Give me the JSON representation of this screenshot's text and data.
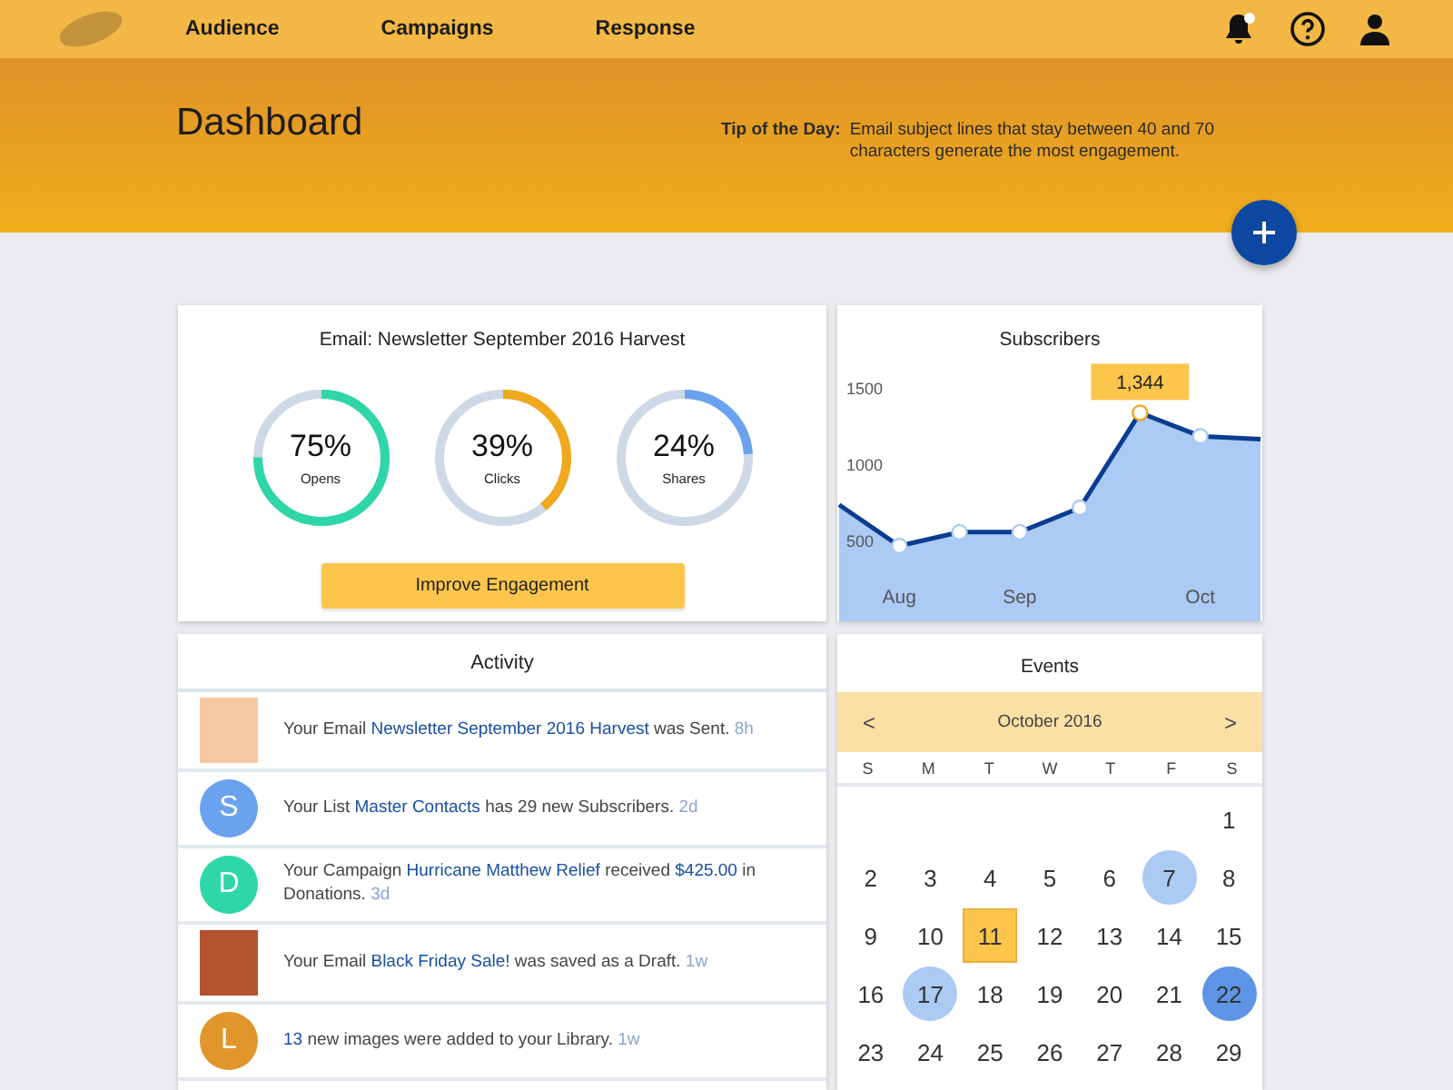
{
  "nav": {
    "items": [
      {
        "label": "Audience"
      },
      {
        "label": "Campaigns"
      },
      {
        "label": "Response"
      }
    ],
    "notifications_unread": true
  },
  "banner": {
    "title": "Dashboard",
    "tip_label": "Tip of the Day:",
    "tip_text": "Email subject lines that stay between 40 and 70 characters generate the most engagement."
  },
  "email_card": {
    "title": "Email: Newsletter September 2016 Harvest",
    "gauges": [
      {
        "value": "75%",
        "label": "Opens",
        "level": 0.75,
        "color": "#2fd6a8"
      },
      {
        "value": "39%",
        "label": "Clicks",
        "level": 0.39,
        "color": "#f0a81c"
      },
      {
        "value": "24%",
        "label": "Shares",
        "level": 0.24,
        "color": "#6aa2ee"
      }
    ],
    "button": "Improve Engagement"
  },
  "subscribers_card": {
    "title": "Subscribers",
    "chart_data": {
      "type": "area",
      "categories": [
        null,
        "Aug",
        null,
        "Sep",
        null,
        null,
        "Oct",
        null
      ],
      "series": [
        {
          "color": "#0a3d91",
          "values": [
            740,
            470,
            560,
            560,
            720,
            1344,
            1190,
            1170
          ]
        }
      ],
      "ylim": [
        -25,
        2050
      ],
      "yticks": [
        500,
        1000,
        1500
      ],
      "annotations": [
        {
          "y": 1344,
          "text": "1,344"
        }
      ]
    }
  },
  "activity": {
    "title": "Activity",
    "items": [
      {
        "kind": "image",
        "segments": [
          {
            "kind": "text",
            "text": "Your Email "
          },
          {
            "kind": "link",
            "text": "Newsletter September 2016 Harvest"
          },
          {
            "kind": "text",
            "text": " was Sent."
          }
        ],
        "time": "8h"
      },
      {
        "kind": "avatar",
        "letter": "S",
        "color": "#6aa2ee",
        "segments": [
          {
            "kind": "text",
            "text": "Your List "
          },
          {
            "kind": "link",
            "text": "Master Contacts"
          },
          {
            "kind": "text",
            "text": " has 29 new Subscribers."
          }
        ],
        "time": "2d"
      },
      {
        "kind": "avatar",
        "letter": "D",
        "color": "#2fd6a8",
        "segments": [
          {
            "kind": "text",
            "text": "Your Campaign "
          },
          {
            "kind": "link",
            "text": "Hurricane Matthew Relief"
          },
          {
            "kind": "text",
            "text": " received "
          },
          {
            "kind": "link",
            "text": "$425.00"
          },
          {
            "kind": "text",
            "text": " in Donations."
          }
        ],
        "time": "3d"
      },
      {
        "kind": "image",
        "segments": [
          {
            "kind": "text",
            "text": "Your Email "
          },
          {
            "kind": "link",
            "text": "Black Friday Sale!"
          },
          {
            "kind": "text",
            "text": " was saved as a Draft."
          }
        ],
        "time": "1w"
      },
      {
        "kind": "avatar",
        "letter": "L",
        "color": "#e0962a",
        "segments": [
          {
            "kind": "link",
            "text": "13"
          },
          {
            "kind": "text",
            "text": " new images were added to your Library."
          }
        ],
        "time": "1w"
      }
    ]
  },
  "events": {
    "title": "Events",
    "prev": "<",
    "month": "October 2016",
    "next": ">",
    "weekdays": [
      "S",
      "M",
      "T",
      "W",
      "T",
      "F",
      "S"
    ],
    "weeks": [
      {
        "days": [
          {
            "day": "1",
            "kind": "plain"
          }
        ]
      },
      {
        "days": [
          {
            "day": "2",
            "kind": "plain"
          },
          {
            "day": "3",
            "kind": "plain"
          },
          {
            "day": "4",
            "kind": "plain"
          },
          {
            "day": "5",
            "kind": "plain"
          },
          {
            "day": "6",
            "kind": "plain"
          },
          {
            "day": "7",
            "kind": "event"
          },
          {
            "day": "8",
            "kind": "plain"
          }
        ]
      },
      {
        "days": [
          {
            "day": "9",
            "kind": "plain"
          },
          {
            "day": "10",
            "kind": "plain"
          },
          {
            "day": "11",
            "kind": "today"
          },
          {
            "day": "12",
            "kind": "plain"
          },
          {
            "day": "13",
            "kind": "plain"
          },
          {
            "day": "14",
            "kind": "plain"
          },
          {
            "day": "15",
            "kind": "plain"
          }
        ]
      },
      {
        "days": [
          {
            "day": "16",
            "kind": "plain"
          },
          {
            "day": "17",
            "kind": "event"
          },
          {
            "day": "18",
            "kind": "plain"
          },
          {
            "day": "19",
            "kind": "plain"
          },
          {
            "day": "20",
            "kind": "plain"
          },
          {
            "day": "21",
            "kind": "plain"
          },
          {
            "day": "22",
            "kind": "selected"
          }
        ]
      },
      {
        "days": [
          {
            "day": "23",
            "kind": "plain"
          },
          {
            "day": "24",
            "kind": "plain"
          },
          {
            "day": "25",
            "kind": "plain"
          },
          {
            "day": "26",
            "kind": "plain"
          },
          {
            "day": "27",
            "kind": "plain"
          },
          {
            "day": "28",
            "kind": "plain"
          },
          {
            "day": "29",
            "kind": "plain"
          }
        ]
      }
    ]
  }
}
